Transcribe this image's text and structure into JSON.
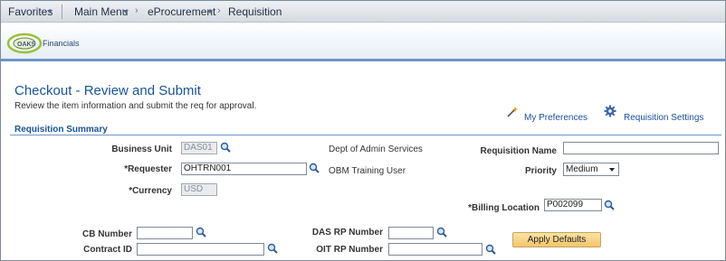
{
  "nav": {
    "favorites": "Favorites",
    "main_menu": "Main Menu",
    "eprocurement": "eProcurement",
    "requisition": "Requisition",
    "chevron": "›"
  },
  "logo": {
    "text": "Financials",
    "mark": "OAKS"
  },
  "page": {
    "title": "Checkout - Review and Submit",
    "subtitle": "Review the item information and submit the req for approval."
  },
  "links": {
    "my_preferences": "My Preferences",
    "requisition_settings": "Requisition Settings"
  },
  "section": {
    "title": "Requisition Summary"
  },
  "form": {
    "business_unit": {
      "label": "Business Unit",
      "value": "DAS01",
      "description": "Dept of Admin Services"
    },
    "requester": {
      "label": "*Requester",
      "value": "OHTRN001",
      "description": "OBM Training User"
    },
    "currency": {
      "label": "*Currency",
      "value": "USD"
    },
    "requisition_name": {
      "label": "Requisition Name",
      "value": ""
    },
    "priority": {
      "label": "Priority",
      "value": "Medium"
    },
    "billing_location": {
      "label": "*Billing Location",
      "value": "P002099"
    },
    "cb_number": {
      "label": "CB Number",
      "value": ""
    },
    "contract_id": {
      "label": "Contract ID",
      "value": ""
    },
    "das_rp_number": {
      "label": "DAS RP Number",
      "value": ""
    },
    "oit_rp_number": {
      "label": "OIT RP Number",
      "value": ""
    }
  },
  "buttons": {
    "apply_defaults": "Apply Defaults"
  },
  "colors": {
    "title_blue": "#1a5591",
    "link_blue": "#1d4f97",
    "rule_blue": "#6f96c5",
    "button_gold": "#f3c56b"
  }
}
